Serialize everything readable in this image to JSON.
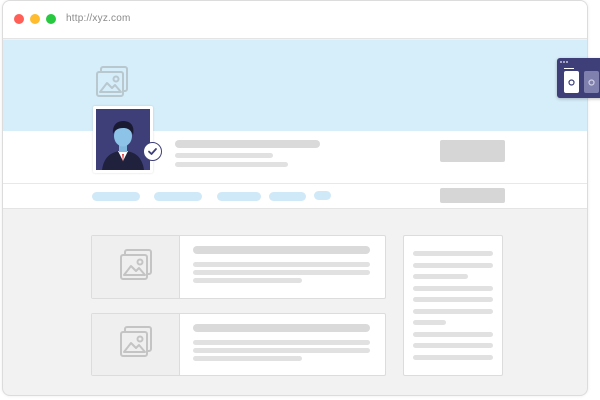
{
  "browser": {
    "url": "http://xyz.com",
    "buttons": [
      "close-button",
      "minimize-button",
      "maximize-button"
    ]
  },
  "colors": {
    "cover_background": "#d6eefa",
    "accent_dark": "#3e3f79",
    "skeleton_gray": "#dadada",
    "skeleton_blue": "#cfe9f8",
    "page_background": "#f2f2f2"
  },
  "icons": {
    "cover": "image-placeholder-icon",
    "avatar": "user-avatar-icon",
    "badge": "checkmark-icon",
    "card_thumbnails": [
      "image-placeholder-icon",
      "image-placeholder-icon"
    ],
    "widget": [
      "settings-icon",
      "settings-icon"
    ]
  }
}
